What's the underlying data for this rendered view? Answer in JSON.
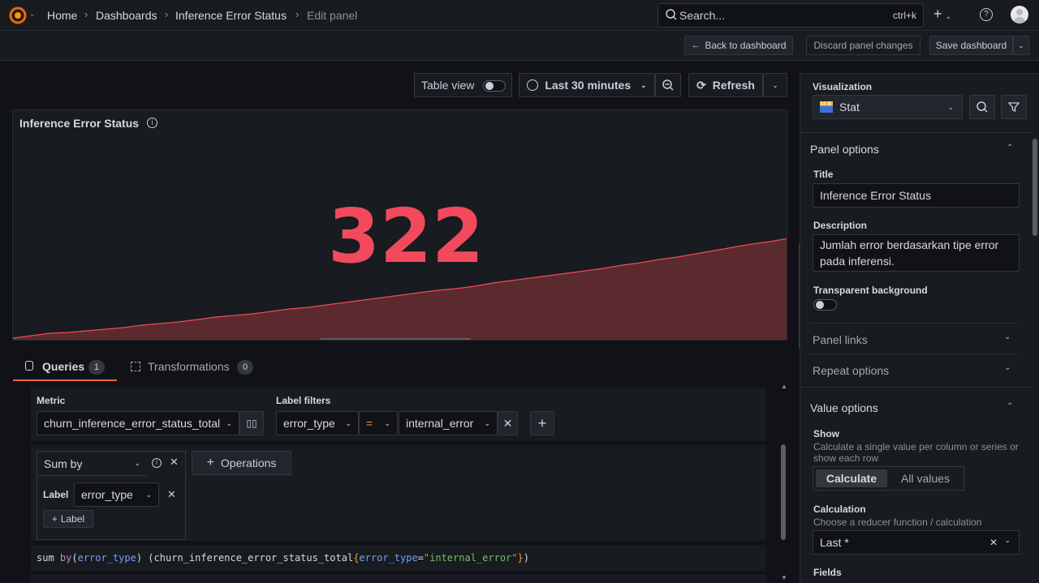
{
  "breadcrumb": {
    "items": [
      "Home",
      "Dashboards",
      "Inference Error Status",
      "Edit panel"
    ]
  },
  "search": {
    "placeholder": "Search...",
    "shortcut": "ctrl+k"
  },
  "toolbar": {
    "back_label": "Back to dashboard",
    "discard_label": "Discard panel changes",
    "save_label": "Save dashboard"
  },
  "panel_toolbar": {
    "table_view_label": "Table view",
    "time_range": "Last 30 minutes",
    "refresh_label": "Refresh"
  },
  "panel": {
    "title": "Inference Error Status",
    "value": "322",
    "value_color": "#f2495c",
    "sparkline": [
      2,
      5,
      8,
      9,
      11,
      13,
      15,
      18,
      20,
      22,
      25,
      28,
      30,
      32,
      35,
      38,
      40,
      43,
      46,
      49,
      52,
      55,
      58,
      61,
      63,
      66,
      70,
      73,
      76,
      79,
      82,
      85,
      88,
      92,
      95,
      99,
      102,
      106,
      110,
      114,
      118,
      121,
      125
    ]
  },
  "tabs": {
    "queries_label": "Queries",
    "queries_count": "1",
    "transformations_label": "Transformations",
    "transformations_count": "0"
  },
  "query": {
    "metric_label": "Metric",
    "metric_value": "churn_inference_error_status_total",
    "label_filters_label": "Label filters",
    "filter_key": "error_type",
    "filter_op": "=",
    "filter_value": "internal_error",
    "operation_name": "Sum by",
    "operations_button": "Operations",
    "label_field_label": "Label",
    "label_value": "error_type",
    "add_label_button": "Label",
    "promql": {
      "fn": "sum",
      "by": "by",
      "group": "error_type",
      "metric": "churn_inference_error_status_total",
      "lkey": "error_type",
      "lval": "\"internal_error\""
    }
  },
  "options": {
    "visualization_label": "Visualization",
    "visualization_value": "Stat",
    "panel_options_label": "Panel options",
    "title_label": "Title",
    "title_value": "Inference Error Status",
    "description_label": "Description",
    "description_value": "Jumlah error berdasarkan tipe error pada inferensi.",
    "transparent_label": "Transparent background",
    "panel_links_label": "Panel links",
    "repeat_options_label": "Repeat options",
    "value_options_label": "Value options",
    "show_label": "Show",
    "show_desc": "Calculate a single value per column or series or show each row",
    "calculate_label": "Calculate",
    "all_values_label": "All values",
    "calculation_label": "Calculation",
    "calculation_desc": "Choose a reducer function / calculation",
    "calculation_value": "Last *",
    "fields_label": "Fields"
  }
}
